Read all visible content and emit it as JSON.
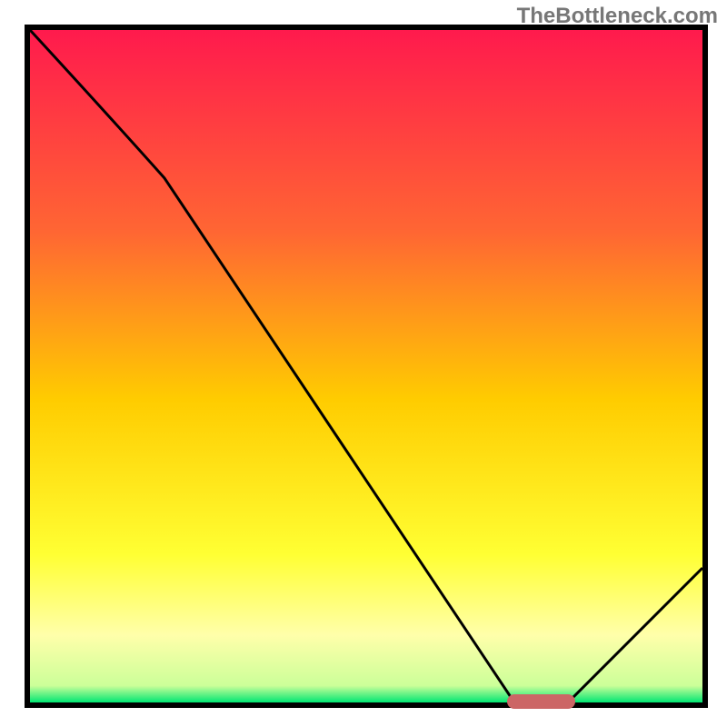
{
  "watermark": "TheBottleneck.com",
  "chart_data": {
    "type": "line",
    "title": "",
    "xlabel": "",
    "ylabel": "",
    "xlim": [
      0,
      100
    ],
    "ylim": [
      0,
      100
    ],
    "series": [
      {
        "name": "bottleneck-curve",
        "x": [
          0,
          20,
          72,
          80,
          100
        ],
        "y": [
          100,
          78,
          0,
          0,
          20
        ]
      }
    ],
    "marker": {
      "name": "optimal-range",
      "x_start": 72,
      "x_end": 80,
      "y": 0,
      "color": "#cc6666"
    },
    "background_gradient": {
      "stops": [
        {
          "pos": 0.0,
          "color": "#ff1a4d"
        },
        {
          "pos": 0.3,
          "color": "#ff6633"
        },
        {
          "pos": 0.55,
          "color": "#ffcc00"
        },
        {
          "pos": 0.78,
          "color": "#ffff33"
        },
        {
          "pos": 0.9,
          "color": "#ffffaa"
        },
        {
          "pos": 0.975,
          "color": "#ccff99"
        },
        {
          "pos": 1.0,
          "color": "#00e673"
        }
      ]
    }
  }
}
